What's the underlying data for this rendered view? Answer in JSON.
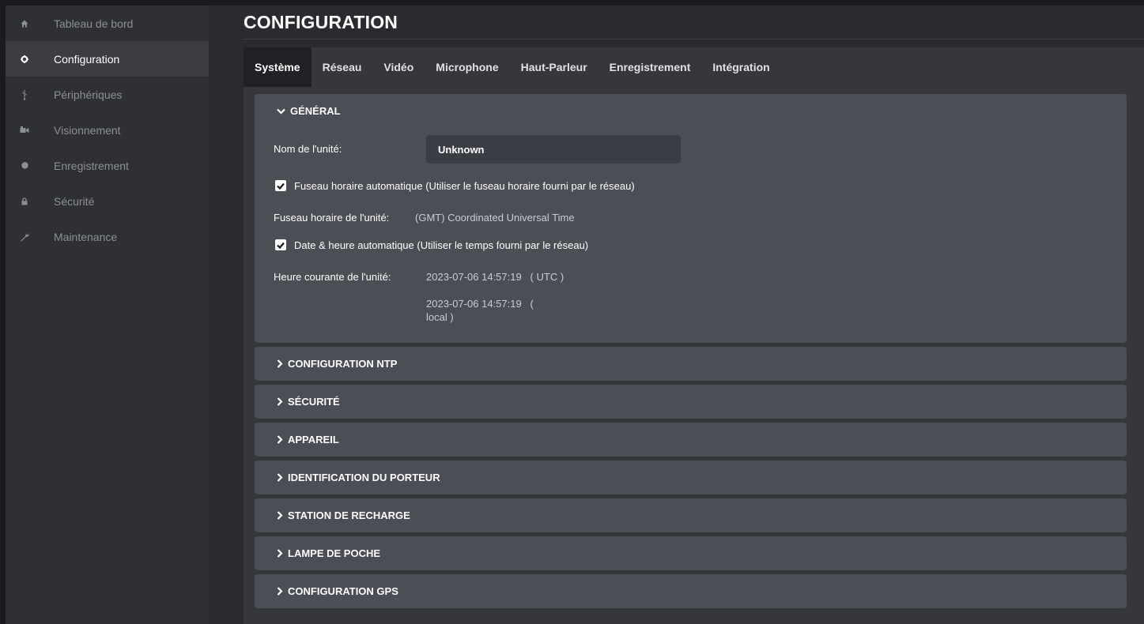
{
  "sidebar": {
    "items": [
      {
        "label": "Tableau de bord",
        "icon": "home-icon"
      },
      {
        "label": "Configuration",
        "icon": "gear-icon"
      },
      {
        "label": "Périphériques",
        "icon": "usb-icon"
      },
      {
        "label": "Visionnement",
        "icon": "video-icon"
      },
      {
        "label": "Enregistrement",
        "icon": "record-dot-icon"
      },
      {
        "label": "Sécurité",
        "icon": "lock-icon"
      },
      {
        "label": "Maintenance",
        "icon": "wrench-icon"
      }
    ],
    "active_index": 1
  },
  "page": {
    "title": "CONFIGURATION"
  },
  "tabs": [
    {
      "label": "Système"
    },
    {
      "label": "Réseau"
    },
    {
      "label": "Vidéo"
    },
    {
      "label": "Microphone"
    },
    {
      "label": "Haut-Parleur"
    },
    {
      "label": "Enregistrement"
    },
    {
      "label": "Intégration"
    }
  ],
  "active_tab": 0,
  "general": {
    "title": "GÉNÉRAL",
    "unit_name_label": "Nom de l'unité:",
    "unit_name_value": "Unknown",
    "auto_timezone_label": "Fuseau horaire automatique (Utiliser le fuseau horaire fourni par le réseau)",
    "auto_timezone_checked": true,
    "timezone_label": "Fuseau horaire de l'unité:",
    "timezone_value": "(GMT) Coordinated Universal Time",
    "auto_datetime_label": "Date & heure automatique (Utiliser le temps fourni par le réseau)",
    "auto_datetime_checked": true,
    "current_time_label": "Heure courante de l'unité:",
    "current_time_utc": "2023-07-06 14:57:19   ( UTC )",
    "current_time_local_line1": "2023-07-06 14:57:19   (",
    "current_time_local_line2": "local )"
  },
  "sections": [
    {
      "title": "CONFIGURATION NTP"
    },
    {
      "title": "SÉCURITÉ"
    },
    {
      "title": "APPAREIL"
    },
    {
      "title": "IDENTIFICATION DU PORTEUR"
    },
    {
      "title": "STATION DE RECHARGE"
    },
    {
      "title": "LAMPE DE POCHE"
    },
    {
      "title": "CONFIGURATION GPS"
    }
  ],
  "colors": {
    "sidebar_bg": "#2e3035",
    "sidebar_active_bg": "#3b3d43",
    "panel_bg": "#4c4e56",
    "input_bg": "#3b3d44",
    "tab_active_bg": "#202124"
  }
}
